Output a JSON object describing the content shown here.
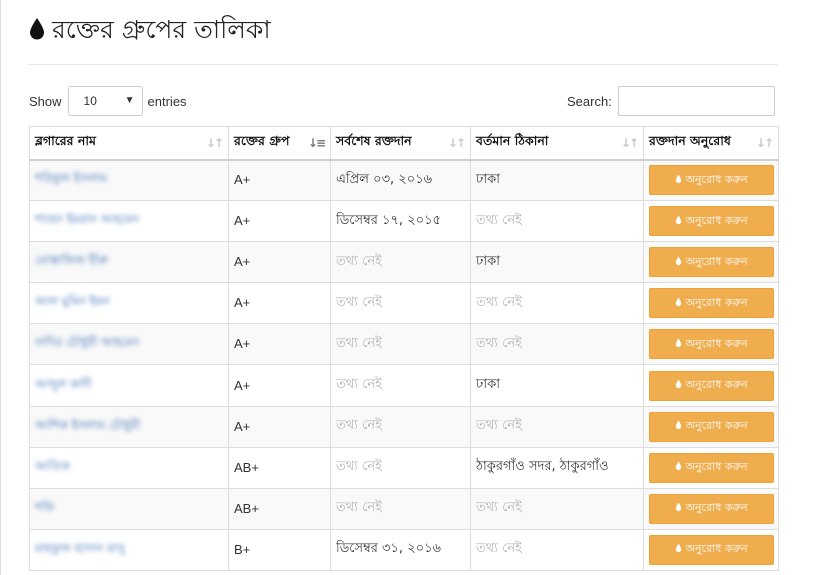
{
  "page": {
    "title": "রক্তের গ্রুপের তালিকা",
    "title_icon": "blood-drop-icon"
  },
  "controls": {
    "show_label": "Show",
    "entries_value": "10",
    "entries_label": "entries",
    "search_label": "Search:",
    "search_value": ""
  },
  "table": {
    "columns": [
      {
        "label": "ব্লগারের নাম",
        "sort": "unsorted"
      },
      {
        "label": "রক্তের গ্রুপ",
        "sort": "ascending"
      },
      {
        "label": "সর্বশেষ রক্তদান",
        "sort": "unsorted"
      },
      {
        "label": "বর্তমান ঠিকানা",
        "sort": "unsorted"
      },
      {
        "label": "রক্তদান অনুরোধ",
        "sort": "unsorted"
      }
    ],
    "button_label": "অনুরোধ করুন",
    "rows": [
      {
        "name": "শরিফুল ইসলাম",
        "group": "A+",
        "last": "এপ্রিল ০৩, ২০১৬",
        "address": "ঢাকা"
      },
      {
        "name": "শাহেদ ইমরান আহমেদ",
        "group": "A+",
        "last": "ডিসেম্বর ১৭, ২০১৫",
        "address": "তথ্য নেই"
      },
      {
        "name": "মোস্তাফিজ হীরু",
        "group": "A+",
        "last": "তথ্য নেই",
        "address": "ঢাকা"
      },
      {
        "name": "আল মুমিন ইমন",
        "group": "A+",
        "last": "তথ্য নেই",
        "address": "তথ্য নেই"
      },
      {
        "name": "নাদির চৌধুরী আহমেদ",
        "group": "A+",
        "last": "তথ্য নেই",
        "address": "তথ্য নেই"
      },
      {
        "name": "আব্দুল কাদী",
        "group": "A+",
        "last": "তথ্য নেই",
        "address": "ঢাকা"
      },
      {
        "name": "আশিক ইসলাম চৌধুরী",
        "group": "A+",
        "last": "তথ্য নেই",
        "address": "তথ্য নেই"
      },
      {
        "name": "আতিক",
        "group": "AB+",
        "last": "তথ্য নেই",
        "address": "ঠাকুরগাঁও সদর, ঠাকুরগাঁও"
      },
      {
        "name": "শফি",
        "group": "AB+",
        "last": "তথ্য নেই",
        "address": "তথ্য নেই"
      },
      {
        "name": "মাহফুজ হাসান রাসু",
        "group": "B+",
        "last": "ডিসেম্বর ৩১, ২০১৬",
        "address": "তথ্য নেই"
      }
    ]
  },
  "colors": {
    "accent": "#f0ad4e",
    "link": "#3a6fb5",
    "muted": "#b3b3b3"
  }
}
